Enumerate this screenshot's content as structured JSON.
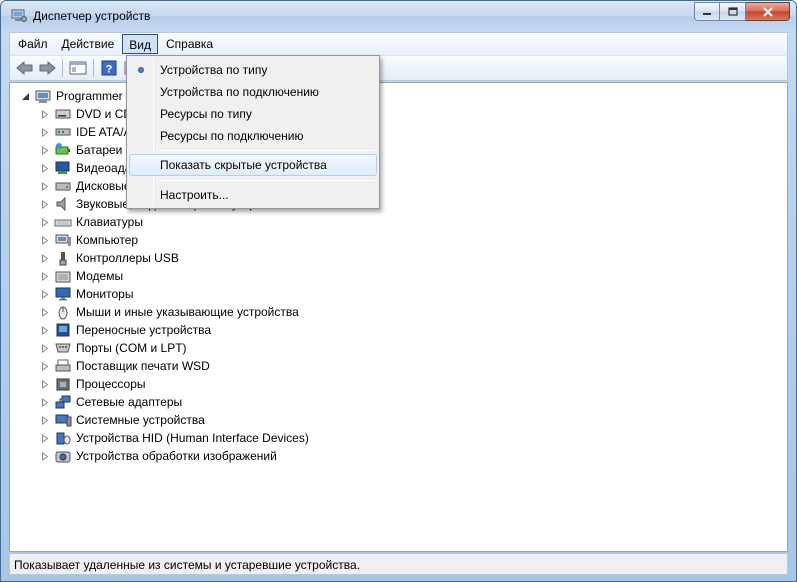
{
  "window": {
    "title": "Диспетчер устройств"
  },
  "menubar": {
    "items": [
      "Файл",
      "Действие",
      "Вид",
      "Справка"
    ],
    "active_index": 2
  },
  "view_menu": {
    "items": [
      {
        "label": "Устройства по типу",
        "checked": true
      },
      {
        "label": "Устройства по подключению",
        "checked": false
      },
      {
        "label": "Ресурсы по типу",
        "checked": false
      },
      {
        "label": "Ресурсы по подключению",
        "checked": false
      },
      {
        "label": "Показать скрытые устройства",
        "checked": false,
        "highlighted": true
      },
      {
        "label": "Настроить...",
        "checked": false
      }
    ]
  },
  "tree": {
    "root": "Programmer",
    "categories": [
      {
        "label": "DVD и CD-ROM дисководы",
        "icon": "dvd-drive-icon"
      },
      {
        "label": "IDE ATA/ATAPI контроллеры",
        "icon": "ide-controller-icon"
      },
      {
        "label": "Батареи",
        "icon": "battery-icon"
      },
      {
        "label": "Видеоадаптеры",
        "icon": "display-adapter-icon"
      },
      {
        "label": "Дисковые устройства",
        "icon": "disk-drive-icon"
      },
      {
        "label": "Звуковые, видео и игровые устройства",
        "icon": "sound-icon"
      },
      {
        "label": "Клавиатуры",
        "icon": "keyboard-icon"
      },
      {
        "label": "Компьютер",
        "icon": "computer-icon"
      },
      {
        "label": "Контроллеры USB",
        "icon": "usb-icon"
      },
      {
        "label": "Модемы",
        "icon": "modem-icon"
      },
      {
        "label": "Мониторы",
        "icon": "monitor-icon"
      },
      {
        "label": "Мыши и иные указывающие устройства",
        "icon": "mouse-icon"
      },
      {
        "label": "Переносные устройства",
        "icon": "portable-device-icon"
      },
      {
        "label": "Порты (COM и LPT)",
        "icon": "port-icon"
      },
      {
        "label": "Поставщик печати WSD",
        "icon": "printer-icon"
      },
      {
        "label": "Процессоры",
        "icon": "processor-icon"
      },
      {
        "label": "Сетевые адаптеры",
        "icon": "network-adapter-icon"
      },
      {
        "label": "Системные устройства",
        "icon": "system-device-icon"
      },
      {
        "label": "Устройства HID (Human Interface Devices)",
        "icon": "hid-icon"
      },
      {
        "label": "Устройства обработки изображений",
        "icon": "imaging-device-icon"
      }
    ]
  },
  "statusbar": {
    "text": "Показывает удаленные из системы и устаревшие устройства."
  }
}
